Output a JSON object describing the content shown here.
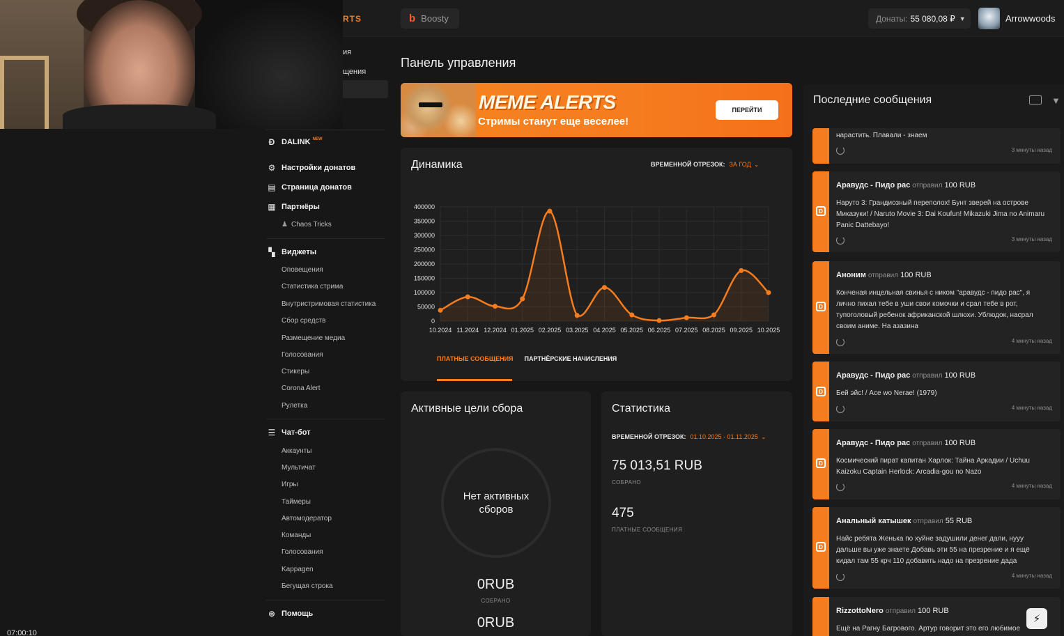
{
  "topbar": {
    "brand_fragment": "RTS",
    "boosty_label": "Boosty",
    "donates_label": "Донаты:",
    "donates_amount": "55 080,08 ₽",
    "username": "Arrowwoods"
  },
  "stream_timer": "07:00:10",
  "sidebar": {
    "partial_items": [
      "ия",
      "щения"
    ],
    "dalink": {
      "label": "DALINK",
      "badge": "NEW"
    },
    "donation_settings": "Настройки донатов",
    "donation_page": "Страница донатов",
    "partners": {
      "label": "Партнёры",
      "items": [
        "Chaos Tricks"
      ]
    },
    "widgets": {
      "label": "Виджеты",
      "items": [
        "Оповещения",
        "Статистика стрима",
        "Внутристримовая статистика",
        "Сбор средств",
        "Размещение медиа",
        "Голосования",
        "Стикеры",
        "Corona Alert",
        "Рулетка"
      ]
    },
    "chatbot": {
      "label": "Чат-бот",
      "items": [
        "Аккаунты",
        "Мультичат",
        "Игры",
        "Таймеры",
        "Автомодератор",
        "Команды",
        "Голосования",
        "Kappagen",
        "Бегущая строка"
      ]
    },
    "help": "Помощь"
  },
  "main": {
    "title": "Панель управления",
    "banner": {
      "logo": "MEME ALERTS",
      "tagline": "Стримы станут еще веселее!",
      "button": "ПЕРЕЙТИ"
    },
    "dynamics": {
      "title": "Динамика",
      "period_label": "ВРЕМЕННОЙ ОТРЕЗОК:",
      "period_value": "ЗА ГОД",
      "tabs": [
        "ПЛАТНЫЕ СООБЩЕНИЯ",
        "ПАРТНЁРСКИЕ НАЧИСЛЕНИЯ"
      ]
    },
    "goals": {
      "title": "Активные цели сбора",
      "empty_line1": "Нет активных",
      "empty_line2": "сборов",
      "collected": "0RUB",
      "collected_label": "СОБРАНО",
      "second": "0RUB"
    },
    "stats": {
      "title": "Статистика",
      "period_label": "ВРЕМЕННОЙ ОТРЕЗОК:",
      "period_value": "01.10.2025 - 01.11.2025",
      "collected": "75 013,51 RUB",
      "collected_label": "СОБРАНО",
      "paid_count": "475",
      "paid_label": "ПЛАТНЫЕ СООБЩЕНИЯ"
    }
  },
  "chart_data": {
    "type": "line",
    "title": "Динамика",
    "categories": [
      "10.2024",
      "11.2024",
      "12.2024",
      "01.2025",
      "02.2025",
      "03.2025",
      "04.2025",
      "05.2025",
      "06.2025",
      "07.2025",
      "08.2025",
      "09.2025",
      "10.2025"
    ],
    "series": [
      {
        "name": "ПЛАТНЫЕ СООБЩЕНИЯ",
        "values": [
          38000,
          85000,
          52000,
          78000,
          385000,
          20000,
          118000,
          22000,
          2000,
          12000,
          22000,
          177000,
          100000
        ]
      }
    ],
    "yticks": [
      0,
      50000,
      100000,
      150000,
      200000,
      250000,
      300000,
      350000,
      400000
    ],
    "ylim": [
      0,
      400000
    ],
    "grid": true,
    "color": "#f57c1f"
  },
  "messages": {
    "title": "Последние сообщения",
    "sent_word": "отправил",
    "items": [
      {
        "author": "",
        "amount": "",
        "text": "нарастить. Плавали - знаем",
        "time": "3 минуты назад"
      },
      {
        "author": "Аравудс - Пидо рас",
        "amount": "100 RUB",
        "text": "Наруто 3: Грандиозный переполох! Бунт зверей на острове Миказуки! / Naruto Movie 3: Dai Koufun! Mikazuki Jima no Animaru Panic Dattebayo!",
        "time": "3 минуты назад"
      },
      {
        "author": "Аноним",
        "amount": "100 RUB",
        "text": "Конченая инцельная свинья с ником \"аравудс - пидо рас\", я лично пихал тебе в уши свои комочки и срал тебе в рот, тупоголовый ребенок африканской шлюхи. Ублюдок, насрал своим аниме. На азазина",
        "time": "4 минуты назад"
      },
      {
        "author": "Аравудс - Пидо рас",
        "amount": "100 RUB",
        "text": "Бей эйс! / Ace wo Nerae! (1979)",
        "time": "4 минуты назад"
      },
      {
        "author": "Аравудс - Пидо рас",
        "amount": "100 RUB",
        "text": "Космический пират капитан Харлок: Тайна Аркадии / Uchuu Kaizoku Captain Herlock: Arcadia-gou no Nazo",
        "time": "4 минуты назад"
      },
      {
        "author": "Анальный катышек",
        "amount": "55 RUB",
        "text": "Найс ребята Женька по хуйне задушили денег дали, нууу дальше вы уже знаете Добавь эти 55 на презрение и я ещё кидал там 55 крч 110 добавить надо на презрение дада",
        "time": "4 минуты назад"
      },
      {
        "author": "RizzottoNero",
        "amount": "100 RUB",
        "text": "Ещё на Рагну Багрового. Артур говорит это его любимое",
        "time": ""
      }
    ]
  },
  "colors": {
    "accent": "#f57c1f",
    "background": "#171717",
    "card": "#1f1f1f"
  }
}
